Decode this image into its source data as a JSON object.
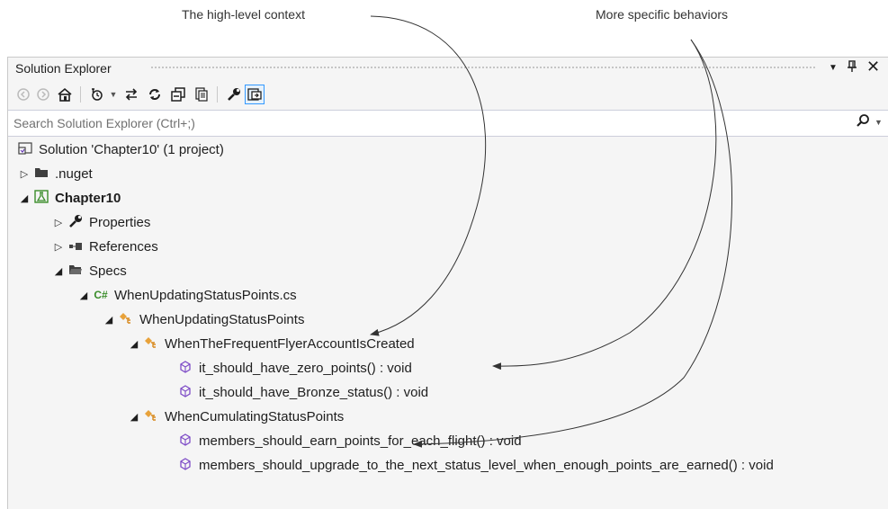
{
  "annotations": {
    "left": "The high-level context",
    "right": "More specific behaviors"
  },
  "panel": {
    "title": "Solution Explorer",
    "title_buttons": [
      "dropdown-arrow-icon",
      "pin-icon",
      "close-icon"
    ]
  },
  "toolbar": {
    "buttons": [
      "back-icon",
      "forward-icon",
      "home-icon",
      "pending-changes-icon",
      "sync-icon",
      "refresh-icon",
      "collapse-all-icon",
      "show-all-files-icon",
      "properties-icon",
      "preview-selected-icon"
    ]
  },
  "search": {
    "placeholder": "Search Solution Explorer (Ctrl+;)"
  },
  "tree": {
    "solution": "Solution 'Chapter10' (1 project)",
    "nuget": ".nuget",
    "project": "Chapter10",
    "properties": "Properties",
    "references": "References",
    "specs": "Specs",
    "file": "WhenUpdatingStatusPoints.cs",
    "class_main": "WhenUpdatingStatusPoints",
    "class_created": "WhenTheFrequentFlyerAccountIsCreated",
    "method_zero": "it_should_have_zero_points() : void",
    "method_bronze": "it_should_have_Bronze_status() : void",
    "class_cumulating": "WhenCumulatingStatusPoints",
    "method_earn": "members_should_earn_points_for_each_flight() : void",
    "method_upgrade": "members_should_upgrade_to_the_next_status_level_when_enough_points_are_earned() : void"
  }
}
